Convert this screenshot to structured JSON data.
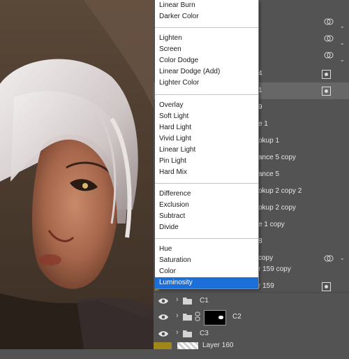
{
  "blend_menu": {
    "groups": [
      [
        "Linear Burn",
        "Darker Color"
      ],
      [
        "Lighten",
        "Screen",
        "Color Dodge",
        "Linear Dodge (Add)",
        "Lighter Color"
      ],
      [
        "Overlay",
        "Soft Light",
        "Hard Light",
        "Vivid Light",
        "Linear Light",
        "Pin Light",
        "Hard Mix"
      ],
      [
        "Difference",
        "Exclusion",
        "Subtract",
        "Divide"
      ],
      [
        "Hue",
        "Saturation",
        "Color",
        "Luminosity"
      ]
    ],
    "selected": "Luminosity",
    "highlight_color": "#1c6ed8"
  },
  "layers_panel": {
    "partial_rows": [
      {
        "text": "4",
        "icon": "smart-object-icon"
      },
      {
        "text": "1",
        "icon": "smart-object-icon",
        "selected": true
      },
      {
        "text": "9"
      },
      {
        "text": "e 1"
      },
      {
        "text": "okup 1"
      },
      {
        "text": "ance 5 copy"
      },
      {
        "text": "ance 5"
      },
      {
        "text": "okup 2 copy 2"
      },
      {
        "text": "okup 2 copy"
      },
      {
        "text": "e 1 copy"
      },
      {
        "text": "8"
      },
      {
        "text": "copy",
        "icon": "blend-mode-icon"
      },
      {
        "text": "r 159 copy"
      },
      {
        "text": "r 159",
        "icon": "smart-object-icon"
      }
    ],
    "top_blend_icons": 3,
    "groups": [
      {
        "name": "C1"
      },
      {
        "name": "C2",
        "has_mask": true
      },
      {
        "name": "C3"
      }
    ],
    "last_layer": "Layer 160"
  }
}
